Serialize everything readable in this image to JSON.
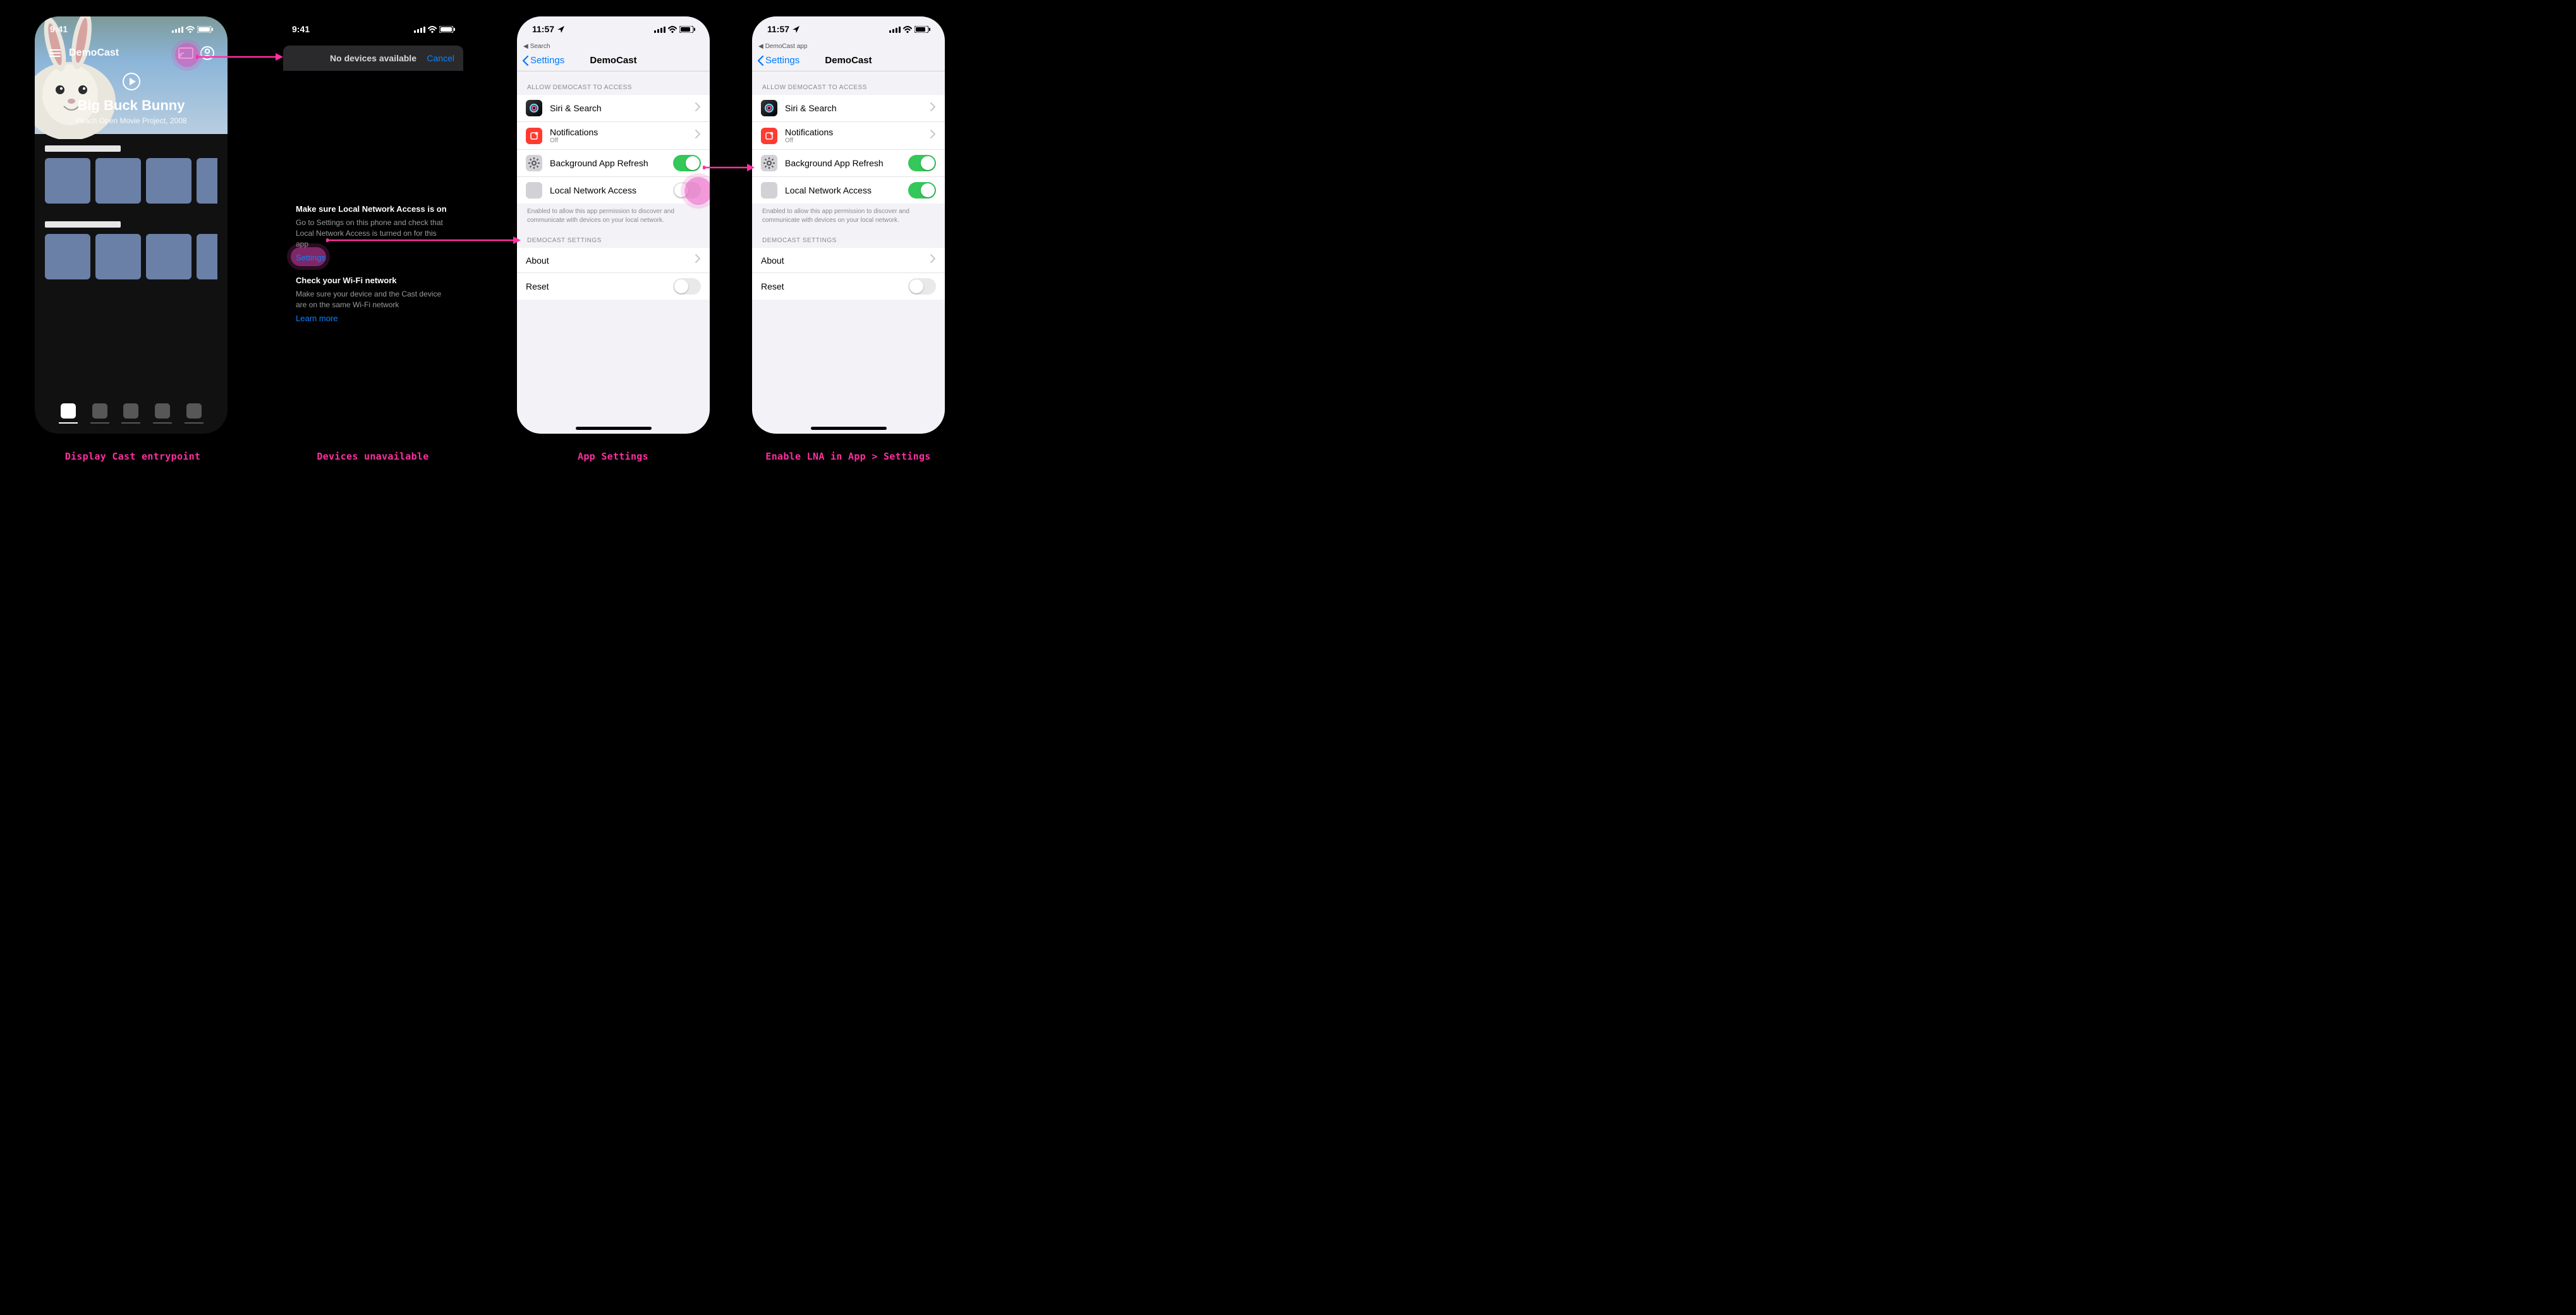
{
  "status_time_a": "9:41",
  "status_time_b": "9:41",
  "status_time_c": "11:57",
  "status_time_d": "11:57",
  "breadcrumb_c": "Search",
  "breadcrumb_d": "DemoCast app",
  "phoneA": {
    "app_name": "DemoCast",
    "hero_title": "Big Buck Bunny",
    "hero_sub": "Peach Open Movie Project, 2008"
  },
  "phoneB": {
    "sheet_title": "No devices available",
    "cancel": "Cancel",
    "help1_title": "Make sure Local Network Access is on",
    "help1_body": "Go to Settings on this phone and check that Local Network Access is turned on for this app",
    "help1_link": "Settings",
    "help2_title": "Check your Wi-Fi network",
    "help2_body": "Make sure your device and the Cast device are on the same Wi-Fi network",
    "help2_link": "Learn more"
  },
  "settings": {
    "back": "Settings",
    "title": "DemoCast",
    "section_allow": "Allow DemoCast to Access",
    "siri": "Siri & Search",
    "notifications": "Notifications",
    "notifications_sub": "Off",
    "bg_refresh": "Background App Refresh",
    "lna": "Local Network Access",
    "lna_note": "Enabled to allow this app permission to discover and communicate with devices on your local network.",
    "section_app": "DemoCast Settings",
    "about": "About",
    "reset": "Reset"
  },
  "captions": {
    "a": "Display Cast entrypoint",
    "b": "Devices unavailable",
    "c": "App Settings",
    "d": "Enable LNA in App > Settings"
  }
}
